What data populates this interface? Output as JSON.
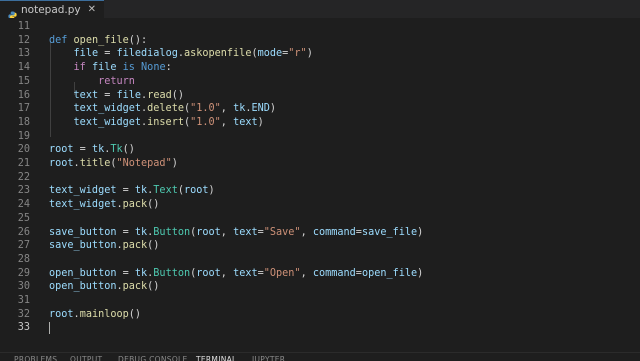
{
  "tab": {
    "filename": "notepad.py",
    "close_glyph": "✕",
    "icon": "python-icon"
  },
  "lines": [
    {
      "num": "11",
      "tokens": []
    },
    {
      "num": "12",
      "tokens": [
        [
          "kw",
          "def "
        ],
        [
          "fn",
          "open_file"
        ],
        [
          "op",
          "():"
        ]
      ]
    },
    {
      "num": "13",
      "tokens": [
        [
          "op",
          "    "
        ],
        [
          "var",
          "file"
        ],
        [
          "op",
          " = "
        ],
        [
          "var",
          "filedialog"
        ],
        [
          "op",
          "."
        ],
        [
          "fn",
          "askopenfile"
        ],
        [
          "op",
          "("
        ],
        [
          "var",
          "mode"
        ],
        [
          "op",
          "="
        ],
        [
          "str",
          "\"r\""
        ],
        [
          "op",
          ")"
        ]
      ]
    },
    {
      "num": "14",
      "tokens": [
        [
          "op",
          "    "
        ],
        [
          "ctl",
          "if "
        ],
        [
          "var",
          "file"
        ],
        [
          "kw",
          " is "
        ],
        [
          "kw",
          "None"
        ],
        [
          "op",
          ":"
        ]
      ]
    },
    {
      "num": "15",
      "tokens": [
        [
          "op",
          "        "
        ],
        [
          "ctl",
          "return"
        ]
      ]
    },
    {
      "num": "16",
      "tokens": [
        [
          "op",
          "    "
        ],
        [
          "var",
          "text"
        ],
        [
          "op",
          " = "
        ],
        [
          "var",
          "file"
        ],
        [
          "op",
          "."
        ],
        [
          "fn",
          "read"
        ],
        [
          "op",
          "()"
        ]
      ]
    },
    {
      "num": "17",
      "tokens": [
        [
          "op",
          "    "
        ],
        [
          "var",
          "text_widget"
        ],
        [
          "op",
          "."
        ],
        [
          "fn",
          "delete"
        ],
        [
          "op",
          "("
        ],
        [
          "str",
          "\"1.0\""
        ],
        [
          "op",
          ", "
        ],
        [
          "var",
          "tk"
        ],
        [
          "op",
          "."
        ],
        [
          "var",
          "END"
        ],
        [
          "op",
          ")"
        ]
      ]
    },
    {
      "num": "18",
      "tokens": [
        [
          "op",
          "    "
        ],
        [
          "var",
          "text_widget"
        ],
        [
          "op",
          "."
        ],
        [
          "fn",
          "insert"
        ],
        [
          "op",
          "("
        ],
        [
          "str",
          "\"1.0\""
        ],
        [
          "op",
          ", "
        ],
        [
          "var",
          "text"
        ],
        [
          "op",
          ")"
        ]
      ]
    },
    {
      "num": "19",
      "tokens": []
    },
    {
      "num": "20",
      "tokens": [
        [
          "var",
          "root"
        ],
        [
          "op",
          " = "
        ],
        [
          "var",
          "tk"
        ],
        [
          "op",
          "."
        ],
        [
          "cls",
          "Tk"
        ],
        [
          "op",
          "()"
        ]
      ]
    },
    {
      "num": "21",
      "tokens": [
        [
          "var",
          "root"
        ],
        [
          "op",
          "."
        ],
        [
          "fn",
          "title"
        ],
        [
          "op",
          "("
        ],
        [
          "str",
          "\"Notepad\""
        ],
        [
          "op",
          ")"
        ]
      ]
    },
    {
      "num": "22",
      "tokens": []
    },
    {
      "num": "23",
      "tokens": [
        [
          "var",
          "text_widget"
        ],
        [
          "op",
          " = "
        ],
        [
          "var",
          "tk"
        ],
        [
          "op",
          "."
        ],
        [
          "cls",
          "Text"
        ],
        [
          "op",
          "("
        ],
        [
          "var",
          "root"
        ],
        [
          "op",
          ")"
        ]
      ]
    },
    {
      "num": "24",
      "tokens": [
        [
          "var",
          "text_widget"
        ],
        [
          "op",
          "."
        ],
        [
          "fn",
          "pack"
        ],
        [
          "op",
          "()"
        ]
      ]
    },
    {
      "num": "25",
      "tokens": []
    },
    {
      "num": "26",
      "tokens": [
        [
          "var",
          "save_button"
        ],
        [
          "op",
          " = "
        ],
        [
          "var",
          "tk"
        ],
        [
          "op",
          "."
        ],
        [
          "cls",
          "Button"
        ],
        [
          "op",
          "("
        ],
        [
          "var",
          "root"
        ],
        [
          "op",
          ", "
        ],
        [
          "var",
          "text"
        ],
        [
          "op",
          "="
        ],
        [
          "str",
          "\"Save\""
        ],
        [
          "op",
          ", "
        ],
        [
          "var",
          "command"
        ],
        [
          "op",
          "="
        ],
        [
          "var",
          "save_file"
        ],
        [
          "op",
          ")"
        ]
      ]
    },
    {
      "num": "27",
      "tokens": [
        [
          "var",
          "save_button"
        ],
        [
          "op",
          "."
        ],
        [
          "fn",
          "pack"
        ],
        [
          "op",
          "()"
        ]
      ]
    },
    {
      "num": "28",
      "tokens": []
    },
    {
      "num": "29",
      "tokens": [
        [
          "var",
          "open_button"
        ],
        [
          "op",
          " = "
        ],
        [
          "var",
          "tk"
        ],
        [
          "op",
          "."
        ],
        [
          "cls",
          "Button"
        ],
        [
          "op",
          "("
        ],
        [
          "var",
          "root"
        ],
        [
          "op",
          ", "
        ],
        [
          "var",
          "text"
        ],
        [
          "op",
          "="
        ],
        [
          "str",
          "\"Open\""
        ],
        [
          "op",
          ", "
        ],
        [
          "var",
          "command"
        ],
        [
          "op",
          "="
        ],
        [
          "var",
          "open_file"
        ],
        [
          "op",
          ")"
        ]
      ]
    },
    {
      "num": "30",
      "tokens": [
        [
          "var",
          "open_button"
        ],
        [
          "op",
          "."
        ],
        [
          "fn",
          "pack"
        ],
        [
          "op",
          "()"
        ]
      ]
    },
    {
      "num": "31",
      "tokens": []
    },
    {
      "num": "32",
      "tokens": [
        [
          "var",
          "root"
        ],
        [
          "op",
          "."
        ],
        [
          "fn",
          "mainloop"
        ],
        [
          "op",
          "()"
        ]
      ]
    },
    {
      "num": "33",
      "tokens": []
    }
  ],
  "active_line": "33",
  "panel_tabs": [
    {
      "label": "PROBLEMS",
      "active": false
    },
    {
      "label": "OUTPUT",
      "active": false
    },
    {
      "label": "DEBUG CONSOLE",
      "active": false
    },
    {
      "label": "TERMINAL",
      "active": true
    },
    {
      "label": "JUPYTER",
      "active": false
    }
  ]
}
